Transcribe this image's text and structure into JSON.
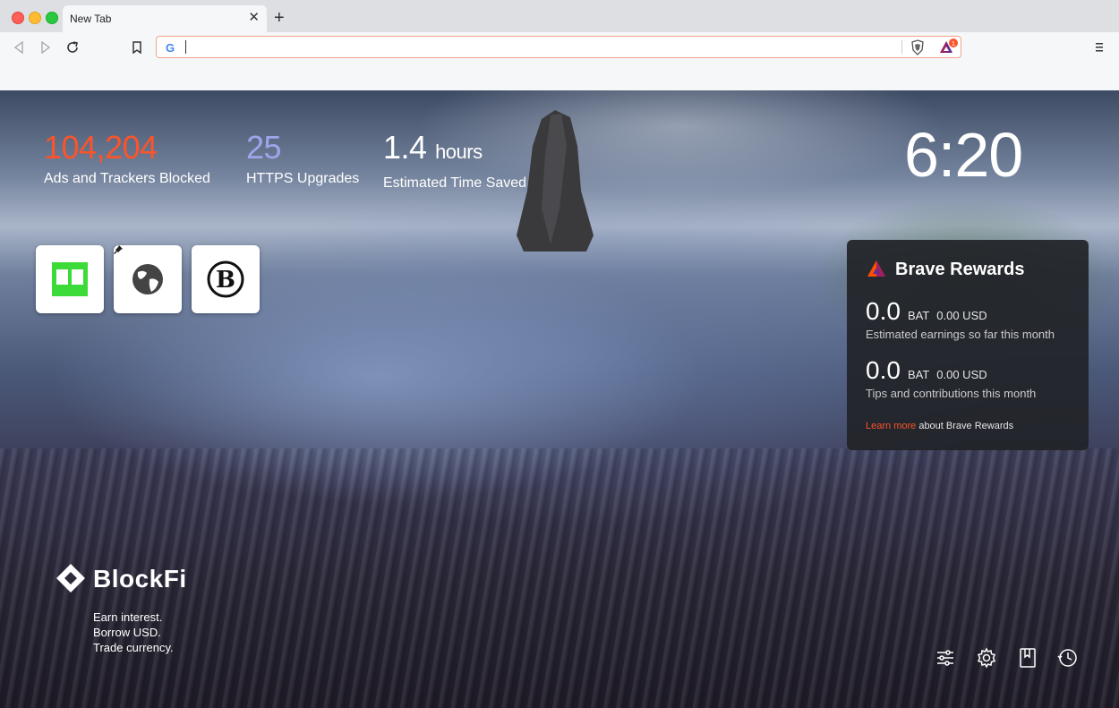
{
  "tab": {
    "title": "New Tab",
    "close": "✕",
    "new": "+"
  },
  "address_bar": {
    "value": "",
    "placeholder": ""
  },
  "rewards_badge": "1",
  "stats": [
    {
      "value": "104,204",
      "unit": "",
      "label": "Ads and Trackers Blocked",
      "color": "#fb542b"
    },
    {
      "value": "25",
      "unit": "",
      "label": "HTTPS Upgrades",
      "color": "#a0a5eb"
    },
    {
      "value": "1.4",
      "unit": "hours",
      "label": "Estimated Time Saved",
      "color": "#ffffff"
    }
  ],
  "clock": "6:20",
  "top_sites": [
    "reader-icon",
    "globe-icon",
    "brand-b-icon"
  ],
  "rewards": {
    "title": "Brave Rewards",
    "earnings": {
      "value": "0.0",
      "currency": "BAT",
      "usd": "0.00 USD",
      "label": "Estimated earnings so far this month"
    },
    "tips": {
      "value": "0.0",
      "currency": "BAT",
      "usd": "0.00 USD",
      "label": "Tips and contributions this month"
    },
    "learn_more": "Learn more",
    "learn_more_suffix": " about Brave Rewards"
  },
  "sponsor": {
    "name": "BlockFi",
    "lines": [
      "Earn interest.",
      "Borrow USD.",
      "Trade currency."
    ]
  },
  "bottom_icons": [
    "customize-icon",
    "settings-icon",
    "bookmarks-icon",
    "history-icon"
  ]
}
